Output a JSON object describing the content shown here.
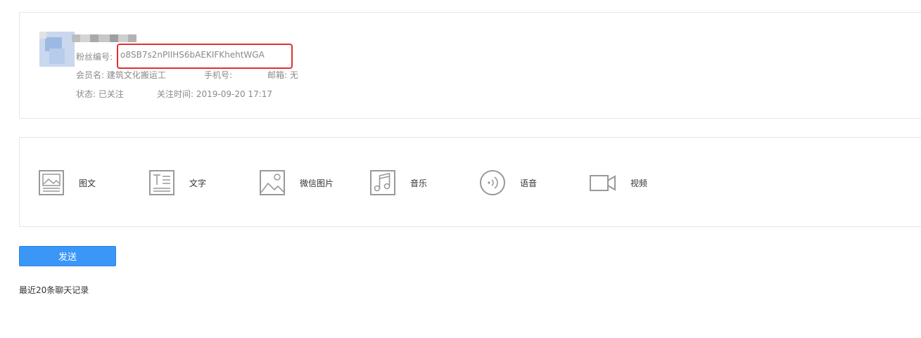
{
  "profile": {
    "fan_id_label": "粉丝编号:",
    "fan_id": "o8SB7s2nPIIHS6bAEKIFKhehtWGA",
    "member_label": "会员名:",
    "member_name": "建筑文化搬运工",
    "phone_label": "手机号:",
    "phone_value": "",
    "email_label": "邮箱:",
    "email_value": "无",
    "status_label": "状态:",
    "status_value": "已关注",
    "follow_time_label": "关注时间:",
    "follow_time_value": "2019-09-20 17:17"
  },
  "message_types": [
    {
      "label": "图文",
      "icon": "news-icon"
    },
    {
      "label": "文字",
      "icon": "text-icon"
    },
    {
      "label": "微信图片",
      "icon": "image-icon"
    },
    {
      "label": "音乐",
      "icon": "music-icon"
    },
    {
      "label": "语音",
      "icon": "voice-icon"
    },
    {
      "label": "视频",
      "icon": "video-icon"
    }
  ],
  "actions": {
    "send_label": "发送"
  },
  "history": {
    "title": "最近20条聊天记录"
  },
  "colors": {
    "primary": "#3a97f8",
    "highlight_border": "#e0312c",
    "border": "#e6e6e6",
    "muted_text": "#8a8a8a"
  }
}
